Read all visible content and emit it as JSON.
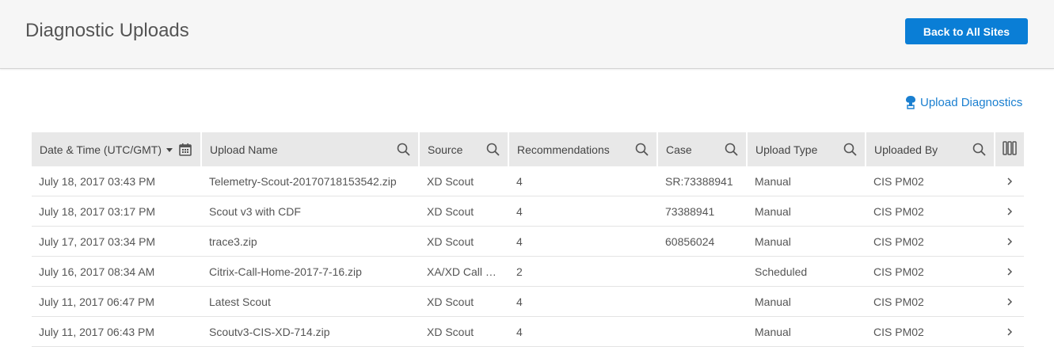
{
  "header": {
    "title": "Diagnostic Uploads",
    "back_button_label": "Back to All Sites"
  },
  "actions": {
    "upload_diagnostics_label": "Upload Diagnostics"
  },
  "table": {
    "columns": [
      {
        "label": "Date & Time (UTC/GMT)",
        "icon": "calendar-icon",
        "sortable": true
      },
      {
        "label": "Upload Name",
        "icon": "search-icon"
      },
      {
        "label": "Source",
        "icon": "search-icon"
      },
      {
        "label": "Recommendations",
        "icon": "search-icon"
      },
      {
        "label": "Case",
        "icon": "search-icon"
      },
      {
        "label": "Upload Type",
        "icon": "search-icon"
      },
      {
        "label": "Uploaded By",
        "icon": "search-icon"
      },
      {
        "label": "",
        "icon": "column-settings-icon"
      }
    ],
    "rows": [
      {
        "date": "July 18, 2017 03:43 PM",
        "name": "Telemetry-Scout-20170718153542.zip",
        "source": "XD Scout",
        "recommendations": "4",
        "case": "SR:73388941",
        "type": "Manual",
        "by": "CIS PM02"
      },
      {
        "date": "July 18, 2017 03:17 PM",
        "name": "Scout v3 with CDF",
        "source": "XD Scout",
        "recommendations": "4",
        "case": "73388941",
        "type": "Manual",
        "by": "CIS PM02"
      },
      {
        "date": "July 17, 2017 03:34 PM",
        "name": "trace3.zip",
        "source": "XD Scout",
        "recommendations": "4",
        "case": "60856024",
        "type": "Manual",
        "by": "CIS PM02"
      },
      {
        "date": "July 16, 2017 08:34 AM",
        "name": "Citrix-Call-Home-2017-7-16.zip",
        "source": "XA/XD Call Ho...",
        "recommendations": "2",
        "case": "",
        "type": "Scheduled",
        "by": "CIS PM02"
      },
      {
        "date": "July 11, 2017 06:47 PM",
        "name": "Latest Scout",
        "source": "XD Scout",
        "recommendations": "4",
        "case": "",
        "type": "Manual",
        "by": "CIS PM02"
      },
      {
        "date": "July 11, 2017 06:43 PM",
        "name": "Scoutv3-CIS-XD-714.zip",
        "source": "XD Scout",
        "recommendations": "4",
        "case": "",
        "type": "Manual",
        "by": "CIS PM02"
      }
    ]
  },
  "colors": {
    "accent": "#0a7ed6",
    "link": "#1a7fd0",
    "header_bg": "#e8e8e8"
  }
}
